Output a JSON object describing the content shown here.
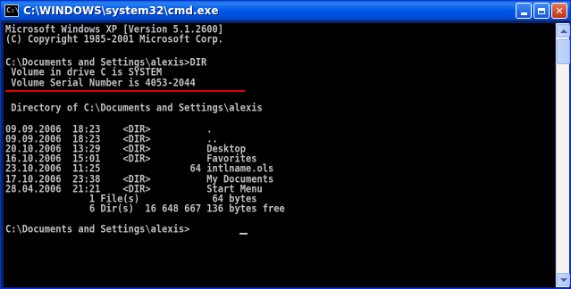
{
  "window": {
    "title": "C:\\WINDOWS\\system32\\cmd.exe",
    "icon_text": "C:\\",
    "accent": "#0058e6"
  },
  "console": {
    "lines": [
      "Microsoft Windows XP [Version 5.1.2600]",
      "(C) Copyright 1985-2001 Microsoft Corp.",
      "",
      "C:\\Documents and Settings\\alexis>DIR",
      " Volume in drive C is SYSTEM",
      " Volume Serial Number is 4053-2044",
      "",
      " Directory of C:\\Documents and Settings\\alexis",
      "",
      "09.09.2006  18:23    <DIR>          .",
      "09.09.2006  18:23    <DIR>          ..",
      "20.10.2006  13:29    <DIR>          Desktop",
      "16.10.2006  15:01    <DIR>          Favorites",
      "23.10.2006  11:25                64 intlname.ols",
      "17.10.2006  23:38    <DIR>          My Documents",
      "28.04.2006  21:21    <DIR>          Start Menu",
      "               1 File(s)             64 bytes",
      "               6 Dir(s)  16 648 667 136 bytes free",
      "",
      "C:\\Documents and Settings\\alexis>"
    ],
    "text_color": "#c0c0c0",
    "background": "#000000",
    "highlight_color": "#e00000"
  }
}
